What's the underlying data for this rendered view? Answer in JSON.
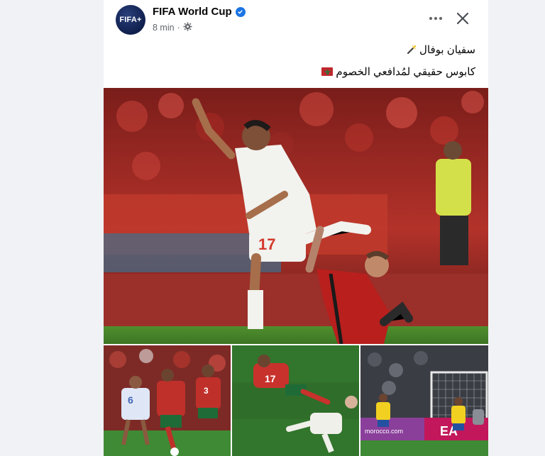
{
  "post": {
    "author": "FIFA World Cup",
    "avatar_text": "FIFA+",
    "time": "8 min",
    "line1": "سفيان بوفال",
    "line2": "كابوس حقيقي لمُدافعي الخصوم"
  },
  "icons": {
    "verified": "verified-badge-icon",
    "audience": "settings-gear-icon",
    "more": "more-dots-icon",
    "close": "close-x-icon",
    "wand": "magic-wand-icon",
    "flag": "morocco-flag-icon"
  },
  "photos": {
    "main_jersey_number": "17",
    "thumb1_numbers": [
      "6",
      "3"
    ],
    "thumb2_number": "17",
    "thumb3_banner": "morocco.com",
    "thumb3_board": "EA"
  },
  "colors": {
    "brand_blue": "#1b74e4",
    "morocco_red": "#c1272d",
    "pitch_green": "#2f6e2a"
  }
}
